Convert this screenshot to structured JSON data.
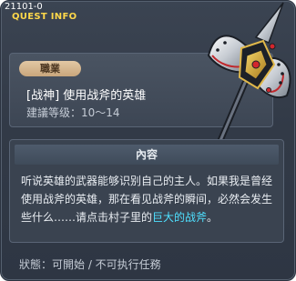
{
  "header": {
    "code": "21101-0",
    "title": "QUEST INFO"
  },
  "quest": {
    "job_tag": "職業",
    "name": "[战神] 使用战斧的英雄",
    "level": "建議等级：10～14"
  },
  "content": {
    "header": "內容",
    "text_before": "听说英雄的武器能够识别自己的主人。如果我是曾经使用战斧的英雄，那在看见战斧的瞬间，必然会发生些什么……请点击村子里的",
    "text_highlight": "巨大的战斧",
    "text_after": "。"
  },
  "status": {
    "text": "狀態：可開始 / 不可执行任務"
  },
  "weapon": {
    "icon": "battle-axe-icon"
  },
  "colors": {
    "title": "#ffd84a",
    "highlight": "#4fe0ff",
    "panel_bg": "#353e4b",
    "tag_bg": "#d6b690"
  }
}
